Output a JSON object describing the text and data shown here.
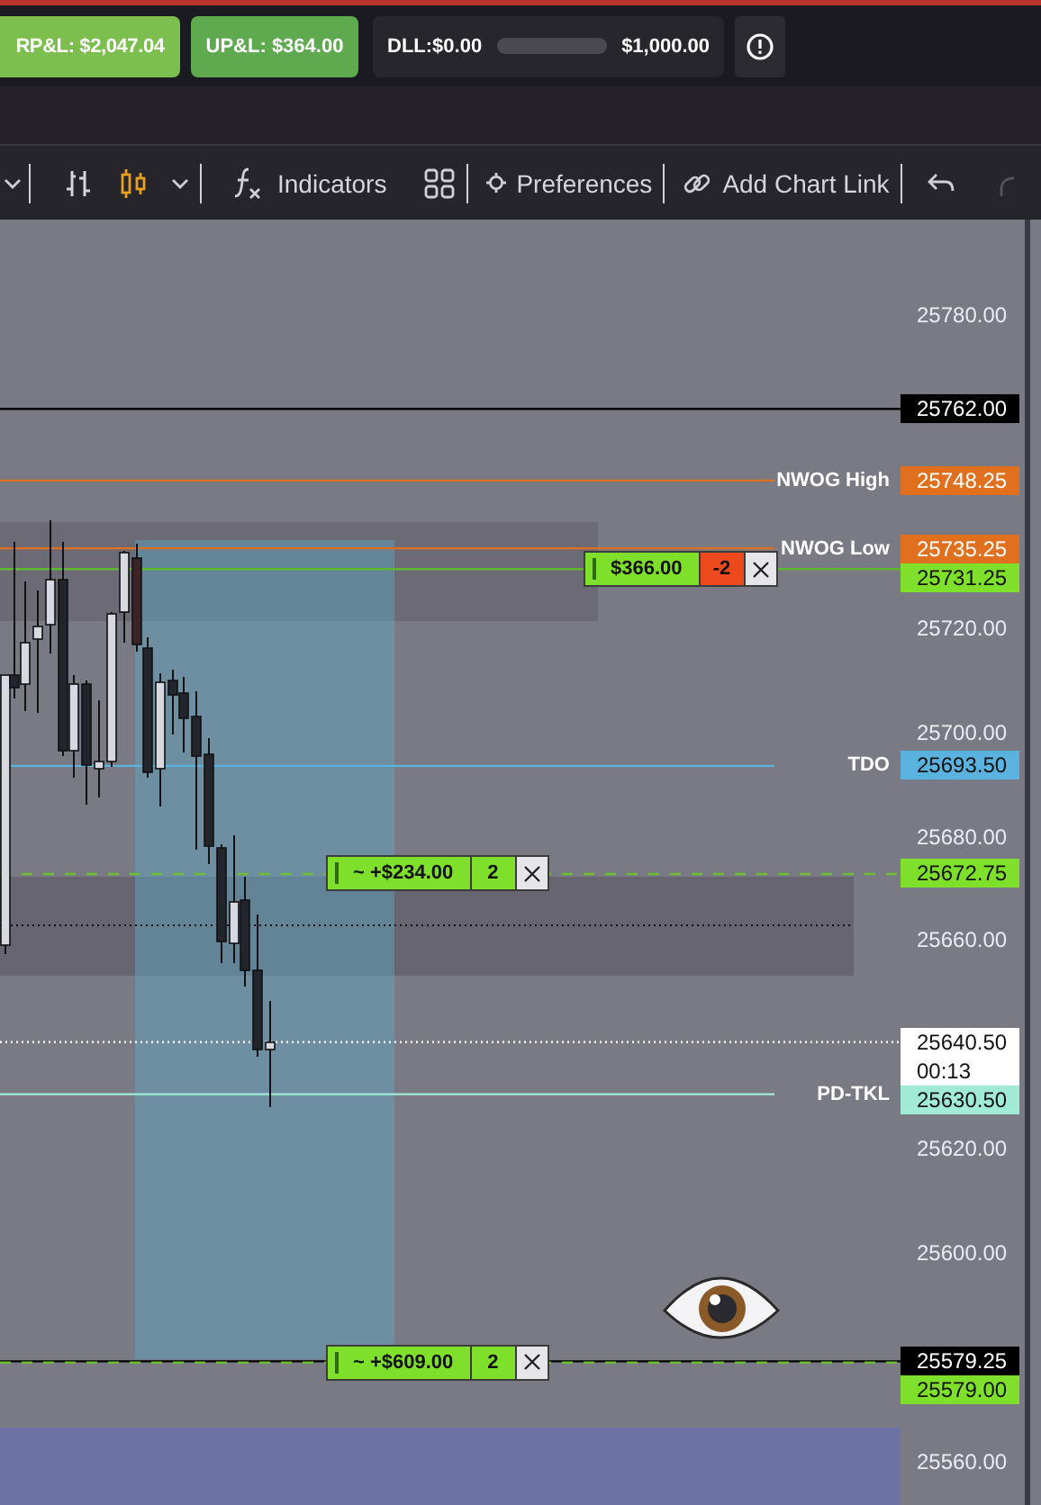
{
  "account": {
    "realized_pnl": "RP&L: $2,047.04",
    "unrealized_pnl": "UP&L: $364.00",
    "daily_loss_limit": {
      "label": "DLL:$0.00",
      "limit": "$1,000.00",
      "level": 0
    }
  },
  "toolbar": {
    "chart_types": [
      {
        "kind": "bars",
        "selected": false
      },
      {
        "kind": "candles",
        "selected": true
      }
    ],
    "buttons": [
      {
        "kind": "indicators",
        "label": "Indicators"
      },
      {
        "kind": "layouts"
      },
      {
        "kind": "preferences",
        "label": "Preferences"
      },
      {
        "kind": "chart_link",
        "label": "Add Chart Link"
      },
      {
        "kind": "undo"
      },
      {
        "kind": "redo"
      }
    ]
  },
  "chart": {
    "price_ticks": [
      "25780.00",
      "25720.00",
      "25700.00",
      "25680.00",
      "25660.00",
      "25620.00",
      "25600.00",
      "25560.00"
    ],
    "levels": [
      {
        "label": "NWOG High",
        "price": "25748.25",
        "color": "#e0701e"
      },
      {
        "label": "NWOG Low",
        "price": "25735.25",
        "color": "#e0701e"
      },
      {
        "label": "TDO",
        "price": "25693.50",
        "color": "#5ab2de"
      },
      {
        "label": "PD-TKL",
        "price": "25630.50",
        "color": "#a0ead6"
      }
    ],
    "price_markers": [
      {
        "kind": "line",
        "price": "25762.00"
      },
      {
        "kind": "position",
        "price": "25731.25",
        "tag": {
          "pnl": "$366.00",
          "quantity": "-2"
        }
      },
      {
        "kind": "order",
        "price": "25672.75",
        "tag": {
          "pnl": "~ +$234.00",
          "quantity": "2"
        }
      },
      {
        "kind": "last",
        "price": "25640.50",
        "timer": "00:13"
      },
      {
        "kind": "line",
        "price": "25579.25"
      },
      {
        "kind": "order",
        "price": "25579.00",
        "tag": {
          "pnl": "~ +$609.00",
          "quantity": "2"
        }
      }
    ]
  }
}
